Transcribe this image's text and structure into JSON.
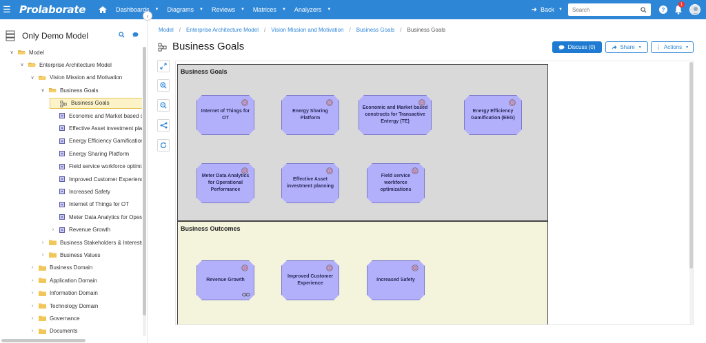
{
  "topbar": {
    "logo": "Prolaborate",
    "nav": [
      {
        "label": "Dashboards"
      },
      {
        "label": "Diagrams"
      },
      {
        "label": "Reviews"
      },
      {
        "label": "Matrices"
      },
      {
        "label": "Analyzers"
      }
    ],
    "back_label": "Back",
    "search_placeholder": "Search",
    "help": "?",
    "notification_count": "1",
    "colors": {
      "bar": "#2e86d6"
    }
  },
  "sidebar": {
    "model_name": "Only Demo Model",
    "tree": [
      {
        "label": "Model",
        "level": 0,
        "kind": "folder-open",
        "chev": "v"
      },
      {
        "label": "Enterprise Architecture Model",
        "level": 1,
        "kind": "folder-open",
        "chev": "v"
      },
      {
        "label": "Vision Mission and Motivation",
        "level": 2,
        "kind": "folder-open",
        "chev": "v"
      },
      {
        "label": "Business Goals",
        "level": 3,
        "kind": "folder-open",
        "chev": "v"
      },
      {
        "label": "Business Goals",
        "level": 4,
        "kind": "diagram",
        "chev": "",
        "selected": true
      },
      {
        "label": "Economic and Market based constructs",
        "level": 4,
        "kind": "element",
        "chev": ""
      },
      {
        "label": "Effective Asset investment planning",
        "level": 4,
        "kind": "element",
        "chev": ""
      },
      {
        "label": "Energy Efficiency Gamification",
        "level": 4,
        "kind": "element",
        "chev": ""
      },
      {
        "label": "Energy Sharing Platform",
        "level": 4,
        "kind": "element",
        "chev": ""
      },
      {
        "label": "Field service workforce optimizations",
        "level": 4,
        "kind": "element",
        "chev": ""
      },
      {
        "label": "Improved Customer Experience",
        "level": 4,
        "kind": "element",
        "chev": ""
      },
      {
        "label": "Increased Safety",
        "level": 4,
        "kind": "element",
        "chev": ""
      },
      {
        "label": "Internet of Things for OT",
        "level": 4,
        "kind": "element",
        "chev": ""
      },
      {
        "label": "Meter Data Analytics for Operational",
        "level": 4,
        "kind": "element",
        "chev": ""
      },
      {
        "label": "Revenue Growth",
        "level": 4,
        "kind": "element",
        "chev": ">"
      },
      {
        "label": "Business Stakeholders & Interests",
        "level": 3,
        "kind": "folder",
        "chev": ">"
      },
      {
        "label": "Business Values",
        "level": 3,
        "kind": "folder",
        "chev": ">"
      },
      {
        "label": "Business Domain",
        "level": 2,
        "kind": "folder",
        "chev": ">"
      },
      {
        "label": "Application Domain",
        "level": 2,
        "kind": "folder",
        "chev": ">"
      },
      {
        "label": "Information Domain",
        "level": 2,
        "kind": "folder",
        "chev": ">"
      },
      {
        "label": "Technology Domain",
        "level": 2,
        "kind": "folder",
        "chev": ">"
      },
      {
        "label": "Governance",
        "level": 2,
        "kind": "folder",
        "chev": ">"
      },
      {
        "label": "Documents",
        "level": 2,
        "kind": "folder",
        "chev": ">"
      }
    ]
  },
  "breadcrumb": [
    {
      "label": "Model",
      "link": true
    },
    {
      "label": "Enterprise Architecture Model",
      "link": true
    },
    {
      "label": "Vision Mission and Motivation",
      "link": true
    },
    {
      "label": "Business Goals",
      "link": true
    },
    {
      "label": "Business Goals",
      "link": false
    }
  ],
  "page": {
    "title": "Business Goals",
    "discuss_label": "Discuss (0)",
    "share_label": "Share",
    "actions_label": "Actions"
  },
  "diagram": {
    "groups": [
      {
        "title": "Business Goals"
      },
      {
        "title": "Business Outcomes"
      }
    ],
    "goals": [
      {
        "label": "Internet of Things for OT",
        "group": 0,
        "col": 0,
        "row": 0
      },
      {
        "label": "Energy Sharing Platform",
        "group": 0,
        "col": 1,
        "row": 0
      },
      {
        "label": "Economic and Market based constructs for Transactive Entergy (TE)",
        "group": 0,
        "col": 2,
        "row": 0
      },
      {
        "label": "Energy Efficiency Gamification (EEG)",
        "group": 0,
        "col": 3,
        "row": 0
      },
      {
        "label": "Meter Data Analytics for Operational Performance",
        "group": 0,
        "col": 0,
        "row": 1
      },
      {
        "label": "Effective Asset investment planning",
        "group": 0,
        "col": 1,
        "row": 1
      },
      {
        "label": "Field service workforce optimizations",
        "group": 0,
        "col": 2,
        "row": 1
      },
      {
        "label": "Revenue Growth",
        "group": 1,
        "col": 0,
        "row": 0,
        "link": true
      },
      {
        "label": "Improved Customer Experience",
        "group": 1,
        "col": 1,
        "row": 0
      },
      {
        "label": "Increased Safety",
        "group": 1,
        "col": 2,
        "row": 0
      }
    ],
    "colors": {
      "goal_fill": "#b3b0fb",
      "goals_bg": "#d9d9d9",
      "outcomes_bg": "#f4f4dc"
    }
  }
}
